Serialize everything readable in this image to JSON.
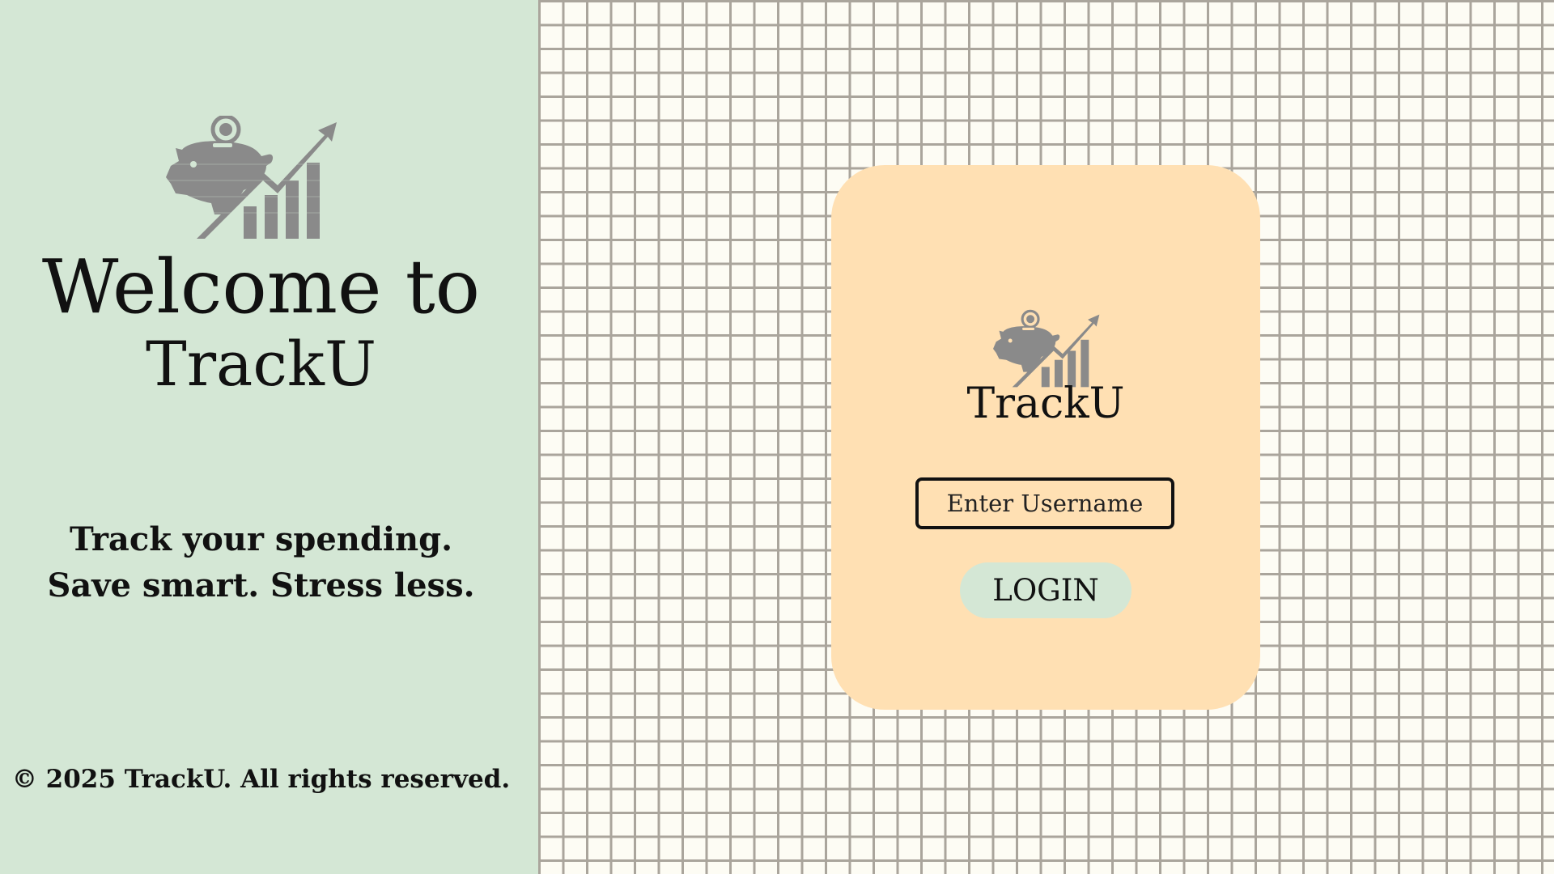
{
  "colors": {
    "left_panel_bg": "#d4e7d5",
    "grid_bg": "#fdfcf4",
    "grid_line": "#aaa59c",
    "card_bg": "#ffe0b3",
    "button_bg": "#d4e7d5",
    "logo_gray": "#8a8a8a",
    "text": "#111111"
  },
  "left_panel": {
    "logo_icon": "piggy-bank-growth-icon",
    "title_line1": "Welcome to",
    "title_line2": "TrackU",
    "tagline": "Track your spending. Save smart. Stress less.",
    "copyright": "© 2025 TrackU. All rights reserved."
  },
  "login_card": {
    "logo_icon": "piggy-bank-growth-icon",
    "title": "TrackU",
    "username_placeholder": "Enter Username",
    "username_value": "",
    "login_label": "LOGIN"
  }
}
